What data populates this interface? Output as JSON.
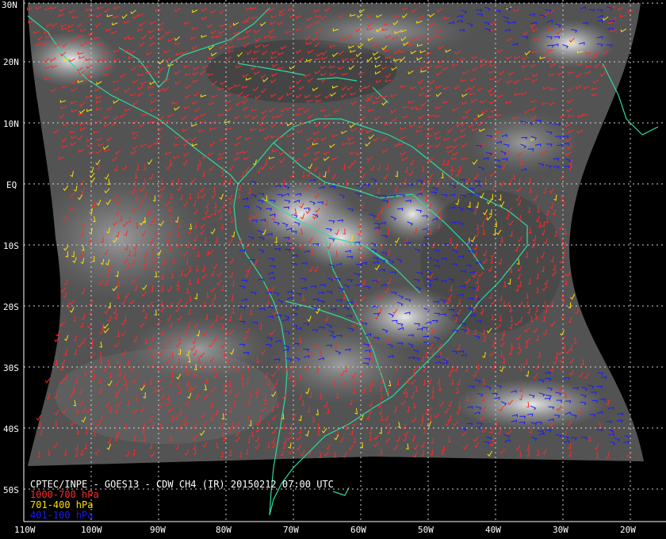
{
  "caption": "CPTEC/INPE - GOES13 - CDW CH4 (IR) 20150212 07:00 UTC",
  "legend": [
    {
      "label": "1000-700 hPa",
      "color": "#ff2a2a"
    },
    {
      "label": "701-400 hPa",
      "color": "#ffe000"
    },
    {
      "label": "401-100 hPa",
      "color": "#1a1aff"
    }
  ],
  "lat_labels": [
    "30N",
    "20N",
    "10N",
    "EQ",
    "10S",
    "20S",
    "30S",
    "40S",
    "50S"
  ],
  "lon_labels": [
    "110W",
    "100W",
    "90W",
    "80W",
    "70W",
    "60W",
    "50W",
    "40W",
    "30W",
    "20W"
  ],
  "colors": {
    "background": "#000000",
    "coastline": "#2fd9a0",
    "grid": "#d0d0d0",
    "cloud_base": "#5a5a5a"
  }
}
